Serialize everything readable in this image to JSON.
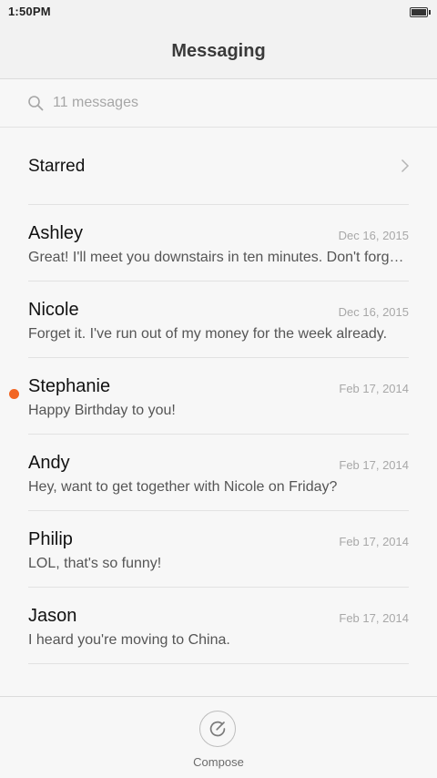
{
  "status_bar": {
    "time": "1:50PM",
    "battery_icon": "battery-full-icon"
  },
  "header": {
    "title": "Messaging"
  },
  "search": {
    "icon": "search-icon",
    "placeholder": "11 messages"
  },
  "starred": {
    "label": "Starred",
    "icon": "chevron-right-icon"
  },
  "conversations": [
    {
      "name": "Ashley",
      "date": "Dec 16, 2015",
      "preview": "Great! I'll meet you downstairs in ten minutes. Don't forget your umbrella.",
      "unread": false
    },
    {
      "name": "Nicole",
      "date": "Dec 16, 2015",
      "preview": "Forget it. I've run out of my money for the week already.",
      "unread": false
    },
    {
      "name": "Stephanie",
      "date": "Feb 17, 2014",
      "preview": "Happy Birthday to you!",
      "unread": true
    },
    {
      "name": "Andy",
      "date": "Feb 17, 2014",
      "preview": "Hey, want to get together with Nicole on Friday?",
      "unread": false
    },
    {
      "name": "Philip",
      "date": "Feb 17, 2014",
      "preview": "LOL, that's so funny!",
      "unread": false
    },
    {
      "name": "Jason",
      "date": "Feb 17, 2014",
      "preview": "I heard you're moving to China.",
      "unread": false
    }
  ],
  "compose": {
    "label": "Compose",
    "icon": "compose-icon"
  },
  "colors": {
    "unread_dot": "#f26522",
    "background": "#f7f7f7"
  }
}
